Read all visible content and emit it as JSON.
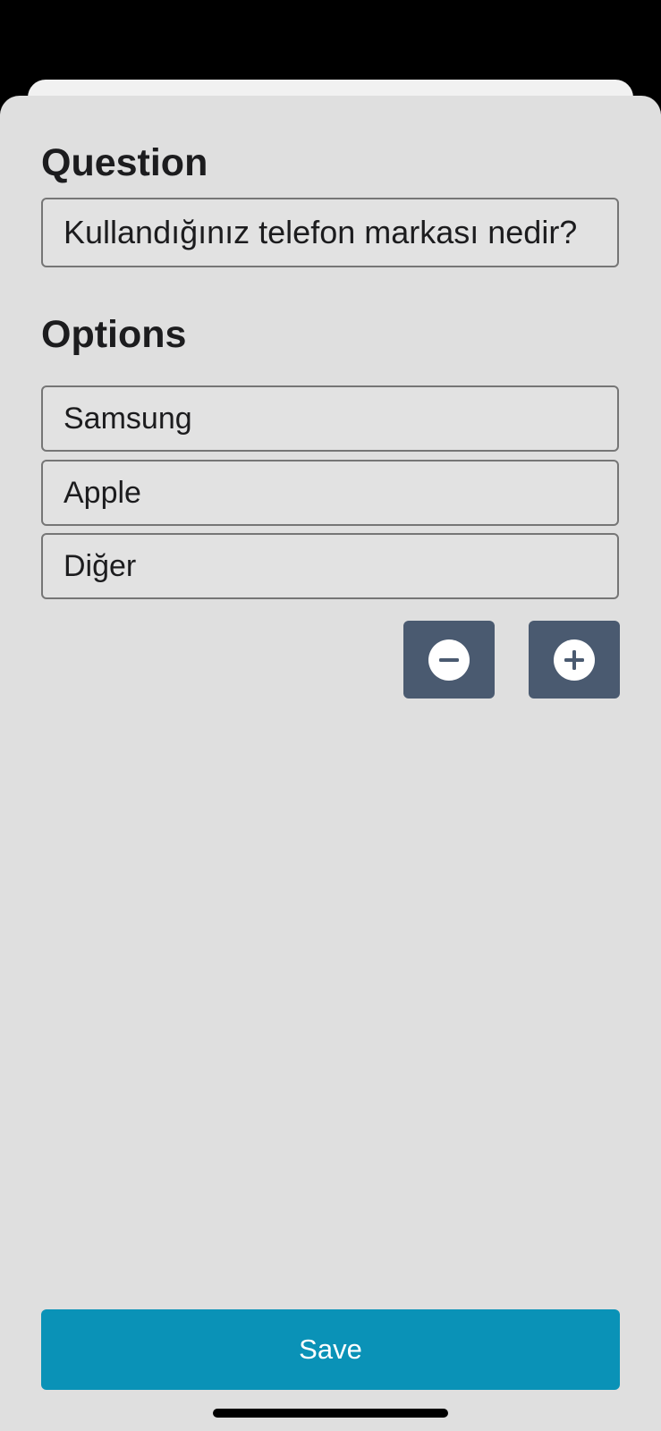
{
  "question": {
    "heading": "Question",
    "value": "Kullandığınız telefon markası nedir?"
  },
  "options": {
    "heading": "Options",
    "items": [
      "Samsung",
      "Apple",
      "Diğer"
    ]
  },
  "controls": {
    "remove_icon": "minus-circle-icon",
    "add_icon": "plus-circle-icon"
  },
  "save_label": "Save",
  "colors": {
    "background": "#000000",
    "sheet": "#dfdfdf",
    "icon_button": "#4a5a70",
    "save_button": "#0a92b7",
    "text": "#1c1c1e"
  }
}
